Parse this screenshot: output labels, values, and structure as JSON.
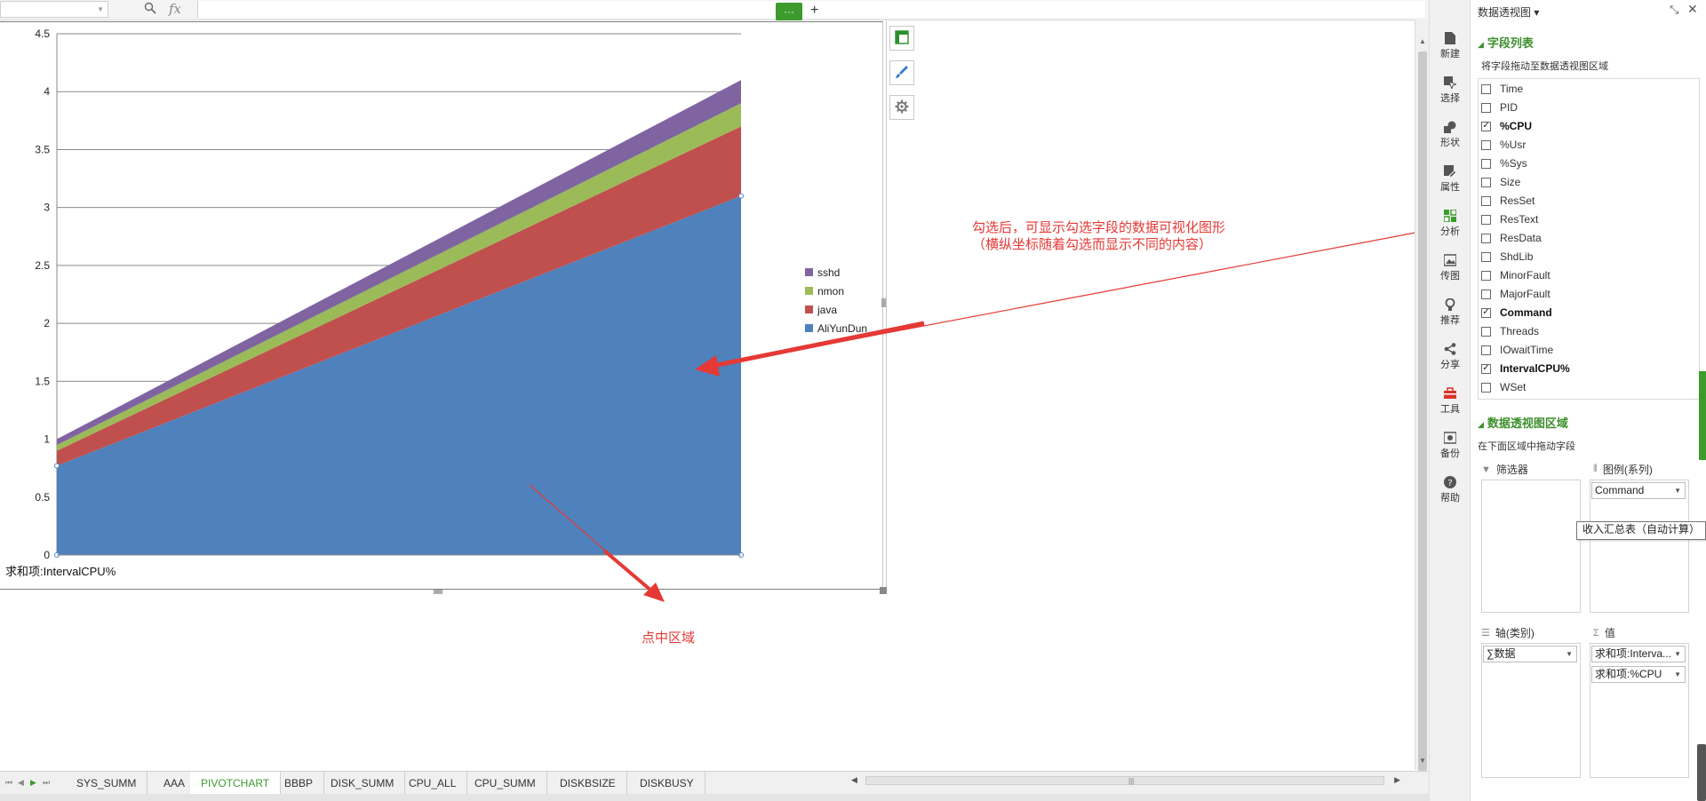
{
  "formula_bar": {
    "name_box_value": "",
    "fx_label": "fx",
    "formula_value": ""
  },
  "chart_data": {
    "type": "area",
    "stacked": true,
    "x": [
      1,
      2
    ],
    "ylim": [
      0,
      4.5
    ],
    "yticks": [
      0,
      0.5,
      1,
      1.5,
      2,
      2.5,
      3,
      3.5,
      4,
      4.5
    ],
    "ytick_labels": [
      "0",
      "0.5",
      "1",
      "1.5",
      "2",
      "2.5",
      "3",
      "3.5",
      "4",
      "4.5"
    ],
    "grid": true,
    "legend_position": "right",
    "series": [
      {
        "name": "AliYunDun",
        "color": "#4f81bd",
        "values": [
          0.77,
          3.1
        ]
      },
      {
        "name": "java",
        "color": "#c0504d",
        "values": [
          0.13,
          0.6
        ]
      },
      {
        "name": "nmon",
        "color": "#9bbb59",
        "values": [
          0.05,
          0.2
        ]
      },
      {
        "name": "sshd",
        "color": "#8064a2",
        "values": [
          0.05,
          0.2
        ]
      }
    ],
    "value_field_label": "求和项:IntervalCPU%"
  },
  "annotations": {
    "arrow_note_line1": "勾选后，可显示勾选字段的数据可视化图形",
    "arrow_note_line2": "（横纵坐标随着勾选而显示不同的内容）",
    "click_note": "点中区域",
    "color": "#e53935"
  },
  "rail": {
    "items": [
      {
        "label": "新建",
        "icon": "new-file-icon"
      },
      {
        "label": "选择",
        "icon": "select-icon"
      },
      {
        "label": "形状",
        "icon": "shape-icon"
      },
      {
        "label": "属性",
        "icon": "properties-icon"
      },
      {
        "label": "分析",
        "icon": "analysis-icon"
      },
      {
        "label": "传图",
        "icon": "upload-image-icon"
      },
      {
        "label": "推荐",
        "icon": "recommend-icon"
      },
      {
        "label": "分享",
        "icon": "share-icon"
      },
      {
        "label": "工具",
        "icon": "toolbox-icon"
      },
      {
        "label": "备份",
        "icon": "backup-icon"
      },
      {
        "label": "帮助",
        "icon": "help-icon"
      }
    ]
  },
  "pivot_panel": {
    "title": "数据透视图 ▾",
    "field_section_title": "字段列表",
    "field_hint": "将字段拖动至数据透视图区域",
    "fields": [
      {
        "name": "Time",
        "checked": false
      },
      {
        "name": "PID",
        "checked": false
      },
      {
        "name": "%CPU",
        "checked": true
      },
      {
        "name": "%Usr",
        "checked": false
      },
      {
        "name": "%Sys",
        "checked": false
      },
      {
        "name": "Size",
        "checked": false
      },
      {
        "name": "ResSet",
        "checked": false
      },
      {
        "name": "ResText",
        "checked": false
      },
      {
        "name": "ResData",
        "checked": false
      },
      {
        "name": "ShdLib",
        "checked": false
      },
      {
        "name": "MinorFault",
        "checked": false
      },
      {
        "name": "MajorFault",
        "checked": false
      },
      {
        "name": "Command",
        "checked": true
      },
      {
        "name": "Threads",
        "checked": false
      },
      {
        "name": "IOwaitTime",
        "checked": false
      },
      {
        "name": "IntervalCPU%",
        "checked": true
      },
      {
        "name": "WSet",
        "checked": false
      }
    ],
    "area_section_title": "数据透视图区域",
    "area_hint": "在下面区域中拖动字段",
    "filter_label": "筛选器",
    "legend_label": "图例(系列)",
    "legend_value": "Command",
    "axis_label": "轴(类别)",
    "axis_value": "∑数据",
    "values_label": "值",
    "value_items": [
      "求和项:Interva...",
      "求和项:%CPU"
    ],
    "tooltip": "收入汇总表（自动计算）"
  },
  "sheet_tabs": {
    "tabs": [
      "SYS_SUMM",
      "AAA",
      "PIVOTCHART",
      "BBBP",
      "DISK_SUMM",
      "CPU_ALL",
      "CPU_SUMM",
      "DISKBSIZE",
      "DISKBUSY"
    ],
    "active": "PIVOTCHART",
    "more_label": "···",
    "add_label": "+"
  }
}
